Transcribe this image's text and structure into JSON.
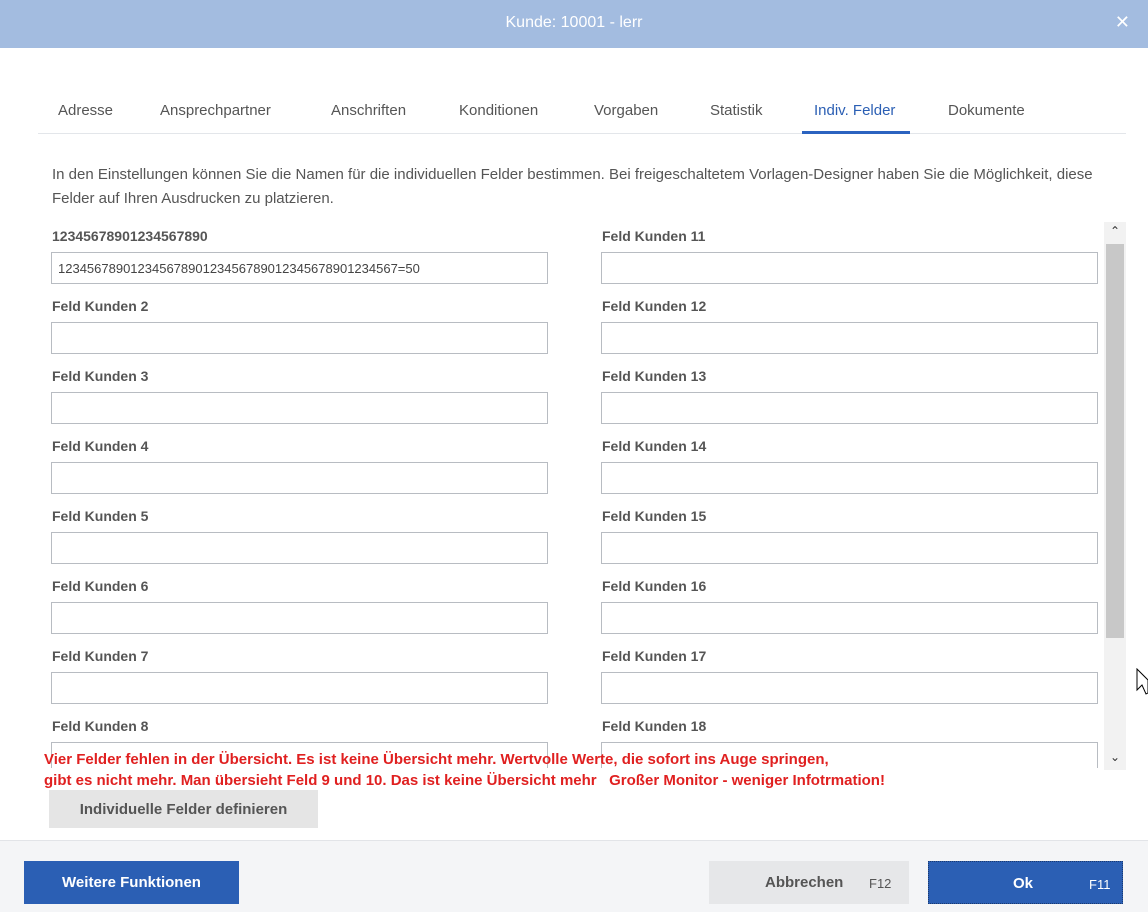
{
  "window": {
    "title": "Kunde: 10001 - lerr",
    "close_glyph": "✕"
  },
  "tabs": [
    {
      "label": "Adresse",
      "active": false
    },
    {
      "label": "Ansprechpartner",
      "active": false
    },
    {
      "label": "Anschriften",
      "active": false
    },
    {
      "label": "Konditionen",
      "active": false
    },
    {
      "label": "Vorgaben",
      "active": false
    },
    {
      "label": "Statistik",
      "active": false
    },
    {
      "label": "Indiv. Felder",
      "active": true
    },
    {
      "label": "Dokumente",
      "active": false
    }
  ],
  "info_text": "In den Einstellungen können Sie die Namen für die individuellen Felder bestimmen. Bei freigeschaltetem Vorlagen-Designer haben Sie die Möglichkeit, diese Felder auf Ihren Ausdrucken zu platzieren.",
  "fields_left": [
    {
      "label": "12345678901234567890",
      "value": "12345678901234567890123456789012345678901234567=50"
    },
    {
      "label": "Feld Kunden 2",
      "value": ""
    },
    {
      "label": "Feld Kunden 3",
      "value": ""
    },
    {
      "label": "Feld Kunden 4",
      "value": ""
    },
    {
      "label": "Feld Kunden 5",
      "value": ""
    },
    {
      "label": "Feld Kunden 6",
      "value": ""
    },
    {
      "label": "Feld Kunden 7",
      "value": ""
    },
    {
      "label": "Feld Kunden 8",
      "value": ""
    }
  ],
  "fields_right": [
    {
      "label": "Feld Kunden 11",
      "value": ""
    },
    {
      "label": "Feld Kunden 12",
      "value": ""
    },
    {
      "label": "Feld Kunden 13",
      "value": ""
    },
    {
      "label": "Feld Kunden 14",
      "value": ""
    },
    {
      "label": "Feld Kunden 15",
      "value": ""
    },
    {
      "label": "Feld Kunden 16",
      "value": ""
    },
    {
      "label": "Feld Kunden 17",
      "value": ""
    },
    {
      "label": "Feld Kunden 18",
      "value": ""
    }
  ],
  "annotation": {
    "line1": "Vier Felder fehlen in der Übersicht. Es ist keine Übersicht mehr. Wertvolle Werte, die sofort ins Auge springen,",
    "line2": "gibt es nicht mehr. Man übersieht Feld 9 und 10. Das ist keine Übersicht mehr   Großer Monitor - weniger Infotrmation!",
    "color": "#e02020"
  },
  "define_button": "Individuelle Felder definieren",
  "footer": {
    "more_button": "Weitere Funktionen",
    "cancel_label": "Abbrechen",
    "cancel_key": "F12",
    "ok_label": "Ok",
    "ok_key": "F11"
  },
  "scrollbar": {
    "up_glyph": "⌃",
    "down_glyph": "⌄"
  },
  "colors": {
    "titlebar": "#a3bce0",
    "accent": "#2b5fb4",
    "annotation": "#e02020"
  }
}
